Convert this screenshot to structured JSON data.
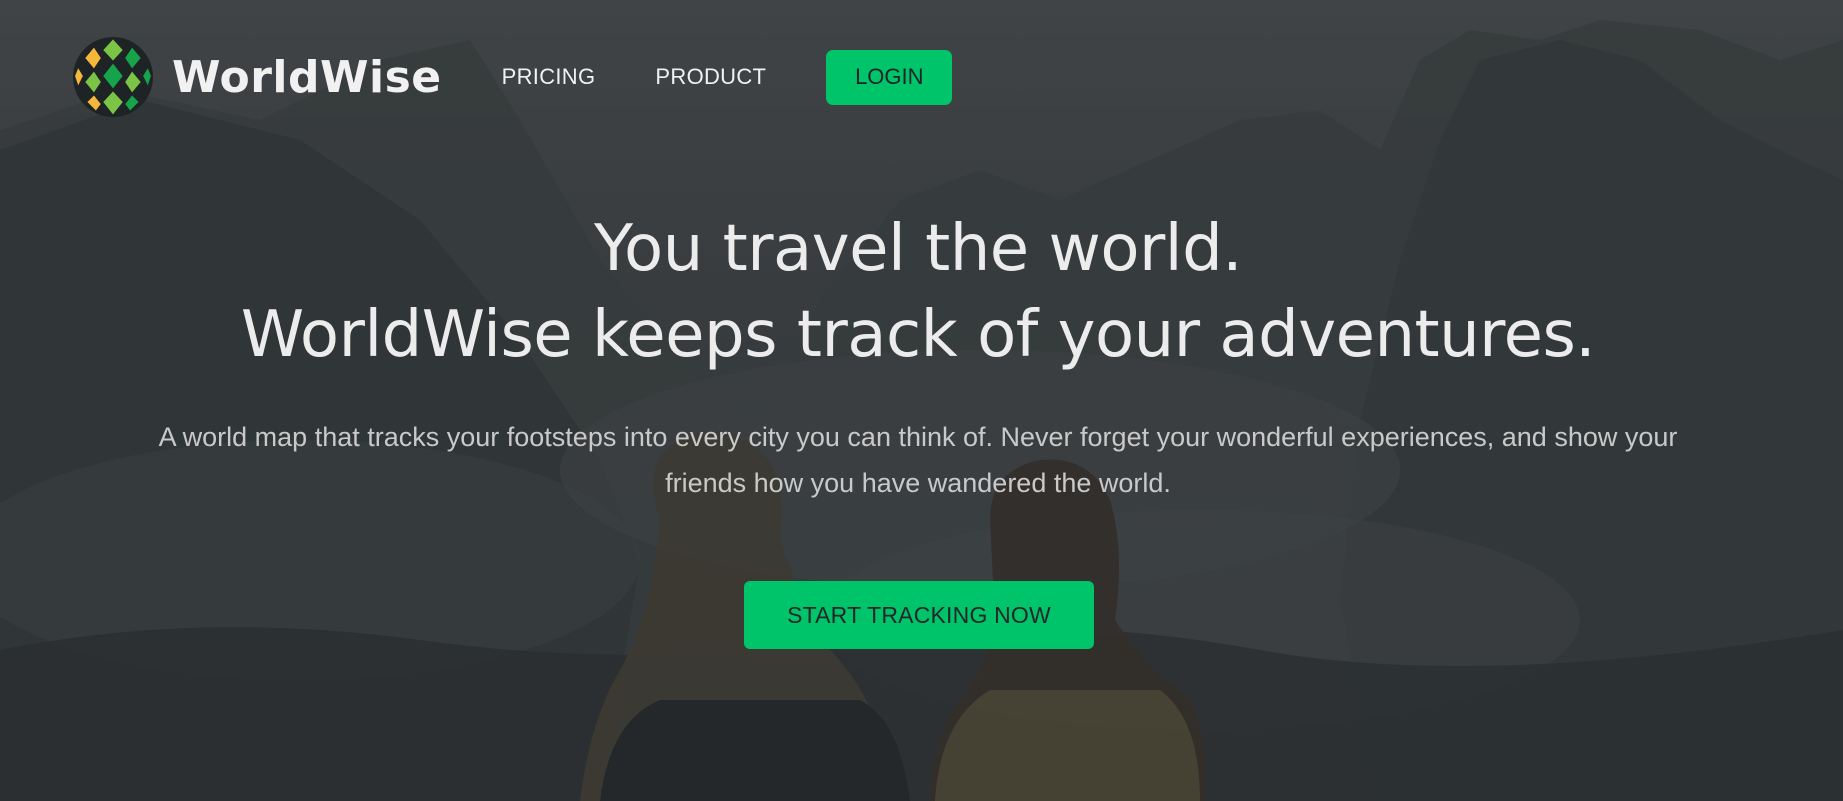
{
  "brand": {
    "name": "WorldWise",
    "colors": {
      "accent": "#00c46a",
      "logo_yellow": "#f6b83b",
      "logo_green_light": "#7bc446",
      "logo_green_dark": "#17a34a"
    }
  },
  "nav": {
    "pricing_label": "PRICING",
    "product_label": "PRODUCT",
    "login_label": "LOGIN"
  },
  "hero": {
    "headline_line1": "You travel the world.",
    "headline_line2": "WorldWise keeps track of your adventures.",
    "subtext": "A world map that tracks your footsteps into every city you can think of. Never forget your wonderful experiences, and show your friends how you have wandered the world.",
    "cta_label": "START TRACKING NOW"
  },
  "icons": [
    "worldwise-logo-icon"
  ]
}
